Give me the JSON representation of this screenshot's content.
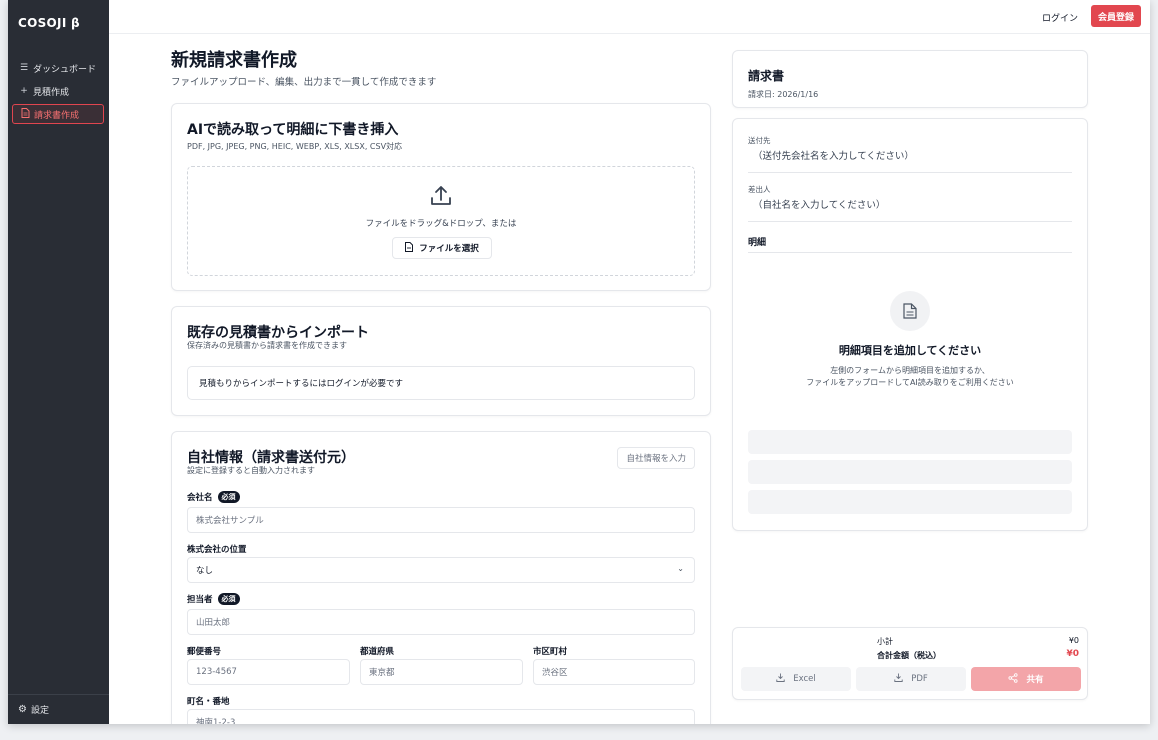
{
  "app": {
    "brand": "COSOJI β"
  },
  "sidebar": {
    "items": [
      {
        "label": "ダッシュボード",
        "icon": "list-icon"
      },
      {
        "label": "見積作成",
        "icon": "plus-icon"
      },
      {
        "label": "請求書作成",
        "icon": "document-icon"
      }
    ],
    "settings_label": "設定"
  },
  "header": {
    "login": "ログイン",
    "signup": "会員登録"
  },
  "page": {
    "title": "新規請求書作成",
    "subtitle": "ファイルアップロード、編集、出力まで一貫して作成できます"
  },
  "ai_upload": {
    "title": "AIで読み取って明細に下書き挿入",
    "formats": "PDF, JPG, JPEG, PNG, HEIC, WEBP, XLS, XLSX, CSV対応",
    "drop_text": "ファイルをドラッグ&ドロップ、または",
    "choose_button": "ファイルを選択"
  },
  "import": {
    "title": "既存の見積書からインポート",
    "subtitle": "保存済みの見積書から請求書を作成できます",
    "notice": "見積もりからインポートするにはログインが必要です"
  },
  "company": {
    "title": "自社情報（請求書送付元）",
    "subtitle": "設定に登録すると自動入力されます",
    "fill_button": "自社情報を入力",
    "required_badge": "必須",
    "name_label": "会社名",
    "name_placeholder": "株式会社サンプル",
    "position_label": "株式会社の位置",
    "position_value": "なし",
    "person_label": "担当者",
    "person_placeholder": "山田太郎",
    "zip_label": "郵便番号",
    "zip_placeholder": "123-4567",
    "pref_label": "都道府県",
    "pref_placeholder": "東京都",
    "city_label": "市区町村",
    "city_placeholder": "渋谷区",
    "street_label": "町名・番地",
    "street_placeholder": "神南1-2-3"
  },
  "preview": {
    "title": "請求書",
    "date": "請求日: 2026/1/16",
    "to_label": "送付先",
    "to_value": "（送付先会社名を入力してください）",
    "from_label": "差出人",
    "from_value": "（自社名を入力してください）",
    "items_label": "明細",
    "empty_title": "明細項目を追加してください",
    "empty_line1": "左側のフォームから明細項目を追加するか、",
    "empty_line2": "ファイルをアップロードしてAI読み取りをご利用ください"
  },
  "totals": {
    "subtotal_label": "小計",
    "subtotal_value": "¥0",
    "total_label": "合計金額（税込）",
    "total_value": "¥0",
    "excel": "Excel",
    "pdf": "PDF",
    "share": "共有"
  },
  "colors": {
    "accent": "#e2474f",
    "sidebar": "#292d35"
  }
}
